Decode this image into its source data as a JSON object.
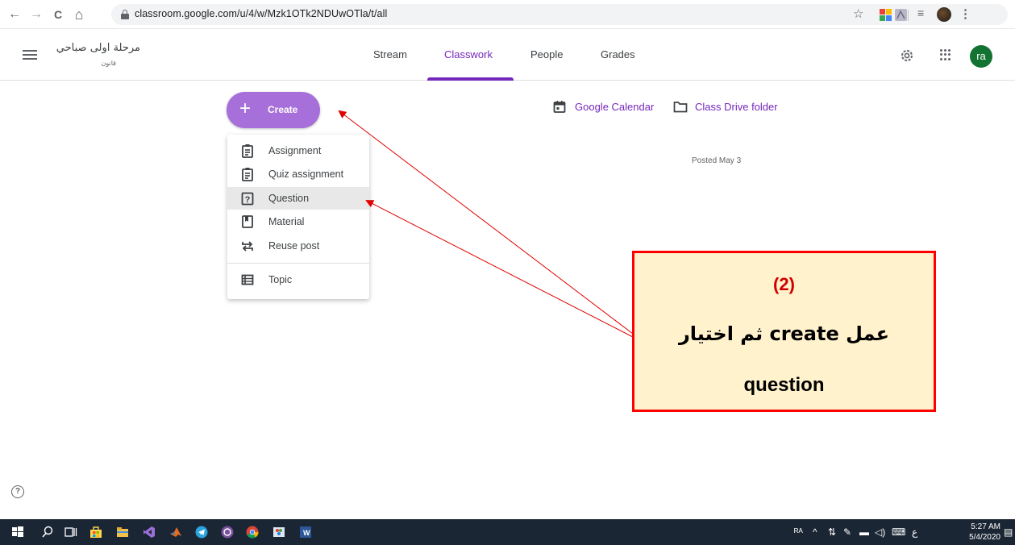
{
  "browser": {
    "back": "←",
    "forward": "→",
    "reload": "C",
    "home": "⌂",
    "url": "classroom.google.com/u/4/w/Mzk1OTk2NDUwOTla/t/all",
    "bookmark_icon": "star-icon"
  },
  "header": {
    "class_name": "مرحلة اولى صباحي",
    "class_section": "قانون",
    "tabs": [
      {
        "label": "Stream",
        "active": false
      },
      {
        "label": "Classwork",
        "active": true
      },
      {
        "label": "People",
        "active": false
      },
      {
        "label": "Grades",
        "active": false
      }
    ],
    "avatar_initials": "ra",
    "accent_color": "#7627bb"
  },
  "main": {
    "create_label": "Create",
    "create_plus": "+",
    "menu": [
      {
        "label": "Assignment",
        "icon": "assignment-icon",
        "highlighted": false
      },
      {
        "label": "Quiz assignment",
        "icon": "quiz-assignment-icon",
        "highlighted": false
      },
      {
        "label": "Question",
        "icon": "question-icon",
        "highlighted": true
      },
      {
        "label": "Material",
        "icon": "material-icon",
        "highlighted": false
      },
      {
        "label": "Reuse post",
        "icon": "reuse-post-icon",
        "highlighted": false
      },
      {
        "label": "Topic",
        "icon": "topic-icon",
        "highlighted": false
      }
    ],
    "calendar_link": "Google Calendar",
    "drive_link": "Class Drive folder",
    "posted": "Posted May 3"
  },
  "annotation": {
    "number": "(2)",
    "line1": "عمل create ثم اختيار",
    "line2": "question",
    "border_color": "#ff0000",
    "fill_color": "#fff2cc"
  },
  "help_icon": "?",
  "taskbar": {
    "time": "5:27 AM",
    "date": "5/4/2020",
    "lang": "ع"
  }
}
